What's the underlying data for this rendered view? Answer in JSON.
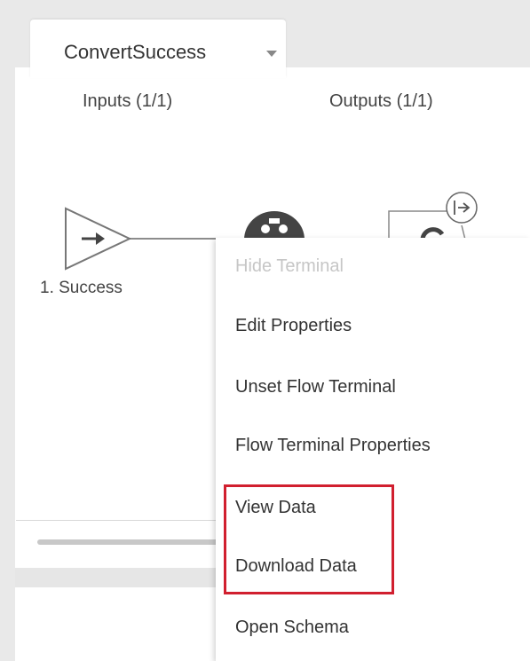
{
  "tab": {
    "label": "ConvertSuccess"
  },
  "columns": {
    "inputs": "Inputs (1/1)",
    "outputs": "Outputs (1/1)"
  },
  "terminal": {
    "label": "1. Success"
  },
  "context_menu": {
    "items": [
      {
        "label": "Hide Terminal",
        "disabled": true
      },
      {
        "label": "Edit Properties",
        "disabled": false
      },
      {
        "label": "Unset Flow Terminal",
        "disabled": false
      },
      {
        "label": "Flow Terminal Properties",
        "disabled": false
      },
      {
        "label": "View Data",
        "disabled": false,
        "highlighted": true
      },
      {
        "label": "Download Data",
        "disabled": false,
        "highlighted": true
      },
      {
        "label": "Open Schema",
        "disabled": false
      }
    ]
  },
  "colors": {
    "highlight": "#d11f2f",
    "disabled_text": "#c6c6c6"
  },
  "icons": {
    "tab_dropdown": "caret-down-icon",
    "input_terminal": "arrow-right-triangle-icon",
    "node": "transform-node-icon",
    "output_terminal": "output-terminal-icon"
  }
}
